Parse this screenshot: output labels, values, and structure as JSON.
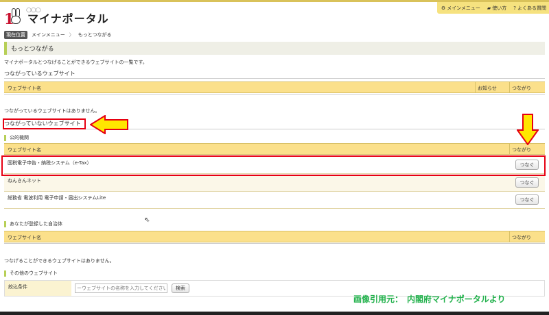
{
  "topmenu": {
    "items": [
      {
        "icon": "gear-icon",
        "glyph": "⚙",
        "label": "メインメニュー"
      },
      {
        "icon": "book-icon",
        "glyph": "▰",
        "label": "使い方"
      },
      {
        "icon": "help-icon",
        "glyph": "?",
        "label": "よくある質問"
      }
    ]
  },
  "logo": {
    "text": "マイナポータル",
    "mark": "1"
  },
  "breadcrumb": {
    "here": "現在位置",
    "items": [
      "メインメニュー",
      "もっとつながる"
    ],
    "sep": "〉"
  },
  "page_title": "もっとつながる",
  "description": "マイナポータルとつなげることができるウェブサイトの一覧です。",
  "connected": {
    "heading": "つながっているウェブサイト",
    "columns": {
      "name": "ウェブサイト名",
      "news": "お知らせ",
      "conn": "つながり"
    },
    "empty": "つながっているウェブサイトはありません。"
  },
  "not_connected": {
    "heading": "つながっていないウェブサイト",
    "public": {
      "heading": "公的機関",
      "columns": {
        "name": "ウェブサイト名",
        "conn": "つながり"
      },
      "rows": [
        {
          "name": "国税電子申告・納税システム（e-Tax）",
          "button": "つなぐ"
        },
        {
          "name": "ねんきんネット",
          "button": "つなぐ"
        },
        {
          "name": "総務省 電波利用 電子申請・届出システムLite",
          "button": "つなぐ"
        }
      ]
    },
    "municipal": {
      "heading": "あなたが登録した自治体",
      "columns": {
        "name": "ウェブサイト名",
        "conn": "つながり"
      },
      "empty": "つなげることができるウェブサイトはありません。"
    },
    "other": {
      "heading": "その他のウェブサイト",
      "filter_label": "絞込条件",
      "placeholder": "ーウェブサイトの名称を入力してください",
      "search_button": "検索"
    }
  },
  "credit": "画像引用元：　内閣府マイナポータルより",
  "colors": {
    "accent": "#b7cf57",
    "header": "#fbe08b",
    "highlight": "#e60012",
    "arrow": "#ffe600",
    "credit": "#22b14c"
  }
}
